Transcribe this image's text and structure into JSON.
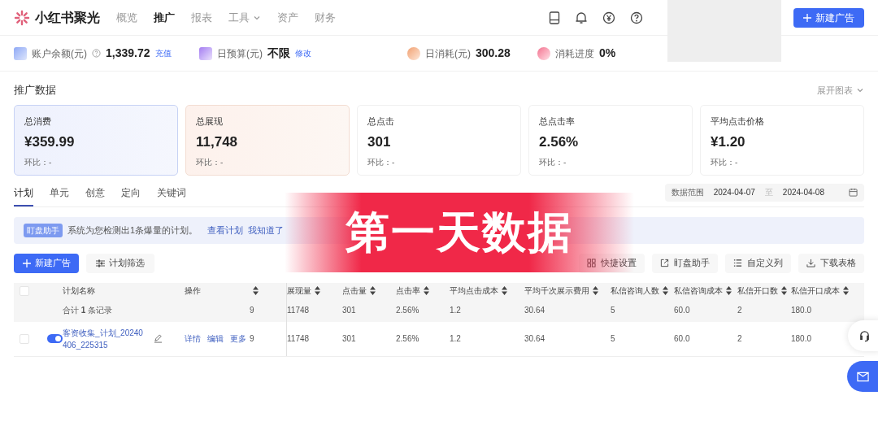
{
  "brand": {
    "name": "小红书聚光"
  },
  "nav": [
    {
      "label": "概览",
      "selected": false
    },
    {
      "label": "推广",
      "selected": true
    },
    {
      "label": "报表",
      "selected": false
    },
    {
      "label": "工具",
      "selected": false,
      "dropdown": true
    },
    {
      "label": "资产",
      "selected": false
    },
    {
      "label": "财务",
      "selected": false
    }
  ],
  "header_button": "新建广告",
  "account_stats": [
    {
      "label": "账户余额(元)",
      "help": true,
      "value": "1,339.72",
      "link": "充值"
    },
    {
      "label": "日预算(元)",
      "value": "不限",
      "link": "修改"
    },
    {
      "label": "日消耗(元)",
      "value": "300.28"
    },
    {
      "label": "消耗进度",
      "value": "0%"
    }
  ],
  "section_title": "推广数据",
  "expand_chart": "展开图表",
  "metric_cards": [
    {
      "title": "总消费",
      "value": "¥359.99",
      "compare": "环比：-",
      "kind": "blue"
    },
    {
      "title": "总展现",
      "value": "11,748",
      "compare": "环比：-",
      "kind": "peach"
    },
    {
      "title": "总点击",
      "value": "301",
      "compare": "环比：-",
      "kind": "plain"
    },
    {
      "title": "总点击率",
      "value": "2.56%",
      "compare": "环比：-",
      "kind": "plain"
    },
    {
      "title": "平均点击价格",
      "value": "¥1.20",
      "compare": "环比：-",
      "kind": "plain"
    }
  ],
  "tabs": [
    {
      "label": "计划",
      "selected": true
    },
    {
      "label": "单元",
      "selected": false
    },
    {
      "label": "创意",
      "selected": false
    },
    {
      "label": "定向",
      "selected": false
    },
    {
      "label": "关键词",
      "selected": false
    }
  ],
  "date_range": {
    "label": "数据范围",
    "start": "2024-04-07",
    "separator": "至",
    "end": "2024-04-08"
  },
  "alert": {
    "badge": "盯盘助手",
    "message": "系统为您检测出1条爆量的计划。",
    "links": [
      "查看计划",
      "我知道了"
    ]
  },
  "toolbar": {
    "primary": "新建广告",
    "filter": "计划筛选",
    "actions": [
      "快捷设置",
      "盯盘助手",
      "自定义列",
      "下载表格"
    ]
  },
  "table": {
    "header_checked": false,
    "columns": [
      {
        "label": "计划名称",
        "sortable": false
      },
      {
        "label": "操作",
        "sortable": false
      },
      {
        "sortable": true
      },
      {
        "label": "展现量",
        "sortable": true
      },
      {
        "label": "点击量",
        "sortable": true
      },
      {
        "label": "点击率",
        "sortable": true
      },
      {
        "label": "平均点击成本",
        "sortable": true
      },
      {
        "label": "平均千次展示费用",
        "sortable": true
      },
      {
        "label": "私信咨询人数",
        "sortable": true
      },
      {
        "label": "私信咨询成本",
        "sortable": true
      },
      {
        "label": "私信开口数",
        "sortable": true
      },
      {
        "label": "私信开口成本",
        "sortable": true
      }
    ],
    "summary": {
      "cells": [
        "合计 **1** 条记录",
        "",
        "9",
        "11748",
        "301",
        "2.56%",
        "1.2",
        "30.64",
        "5",
        "60.0",
        "2",
        "180.0"
      ]
    },
    "rows": [
      {
        "checked": false,
        "on": true,
        "actions": [
          "详情",
          "编辑",
          "更多"
        ],
        "cells": [
          "客资收集_计划_20240406_225315",
          "",
          "9",
          "11748",
          "301",
          "2.56%",
          "1.2",
          "30.64",
          "5",
          "60.0",
          "2",
          "180.0"
        ]
      }
    ]
  },
  "overlay_caption": "第一天数据"
}
